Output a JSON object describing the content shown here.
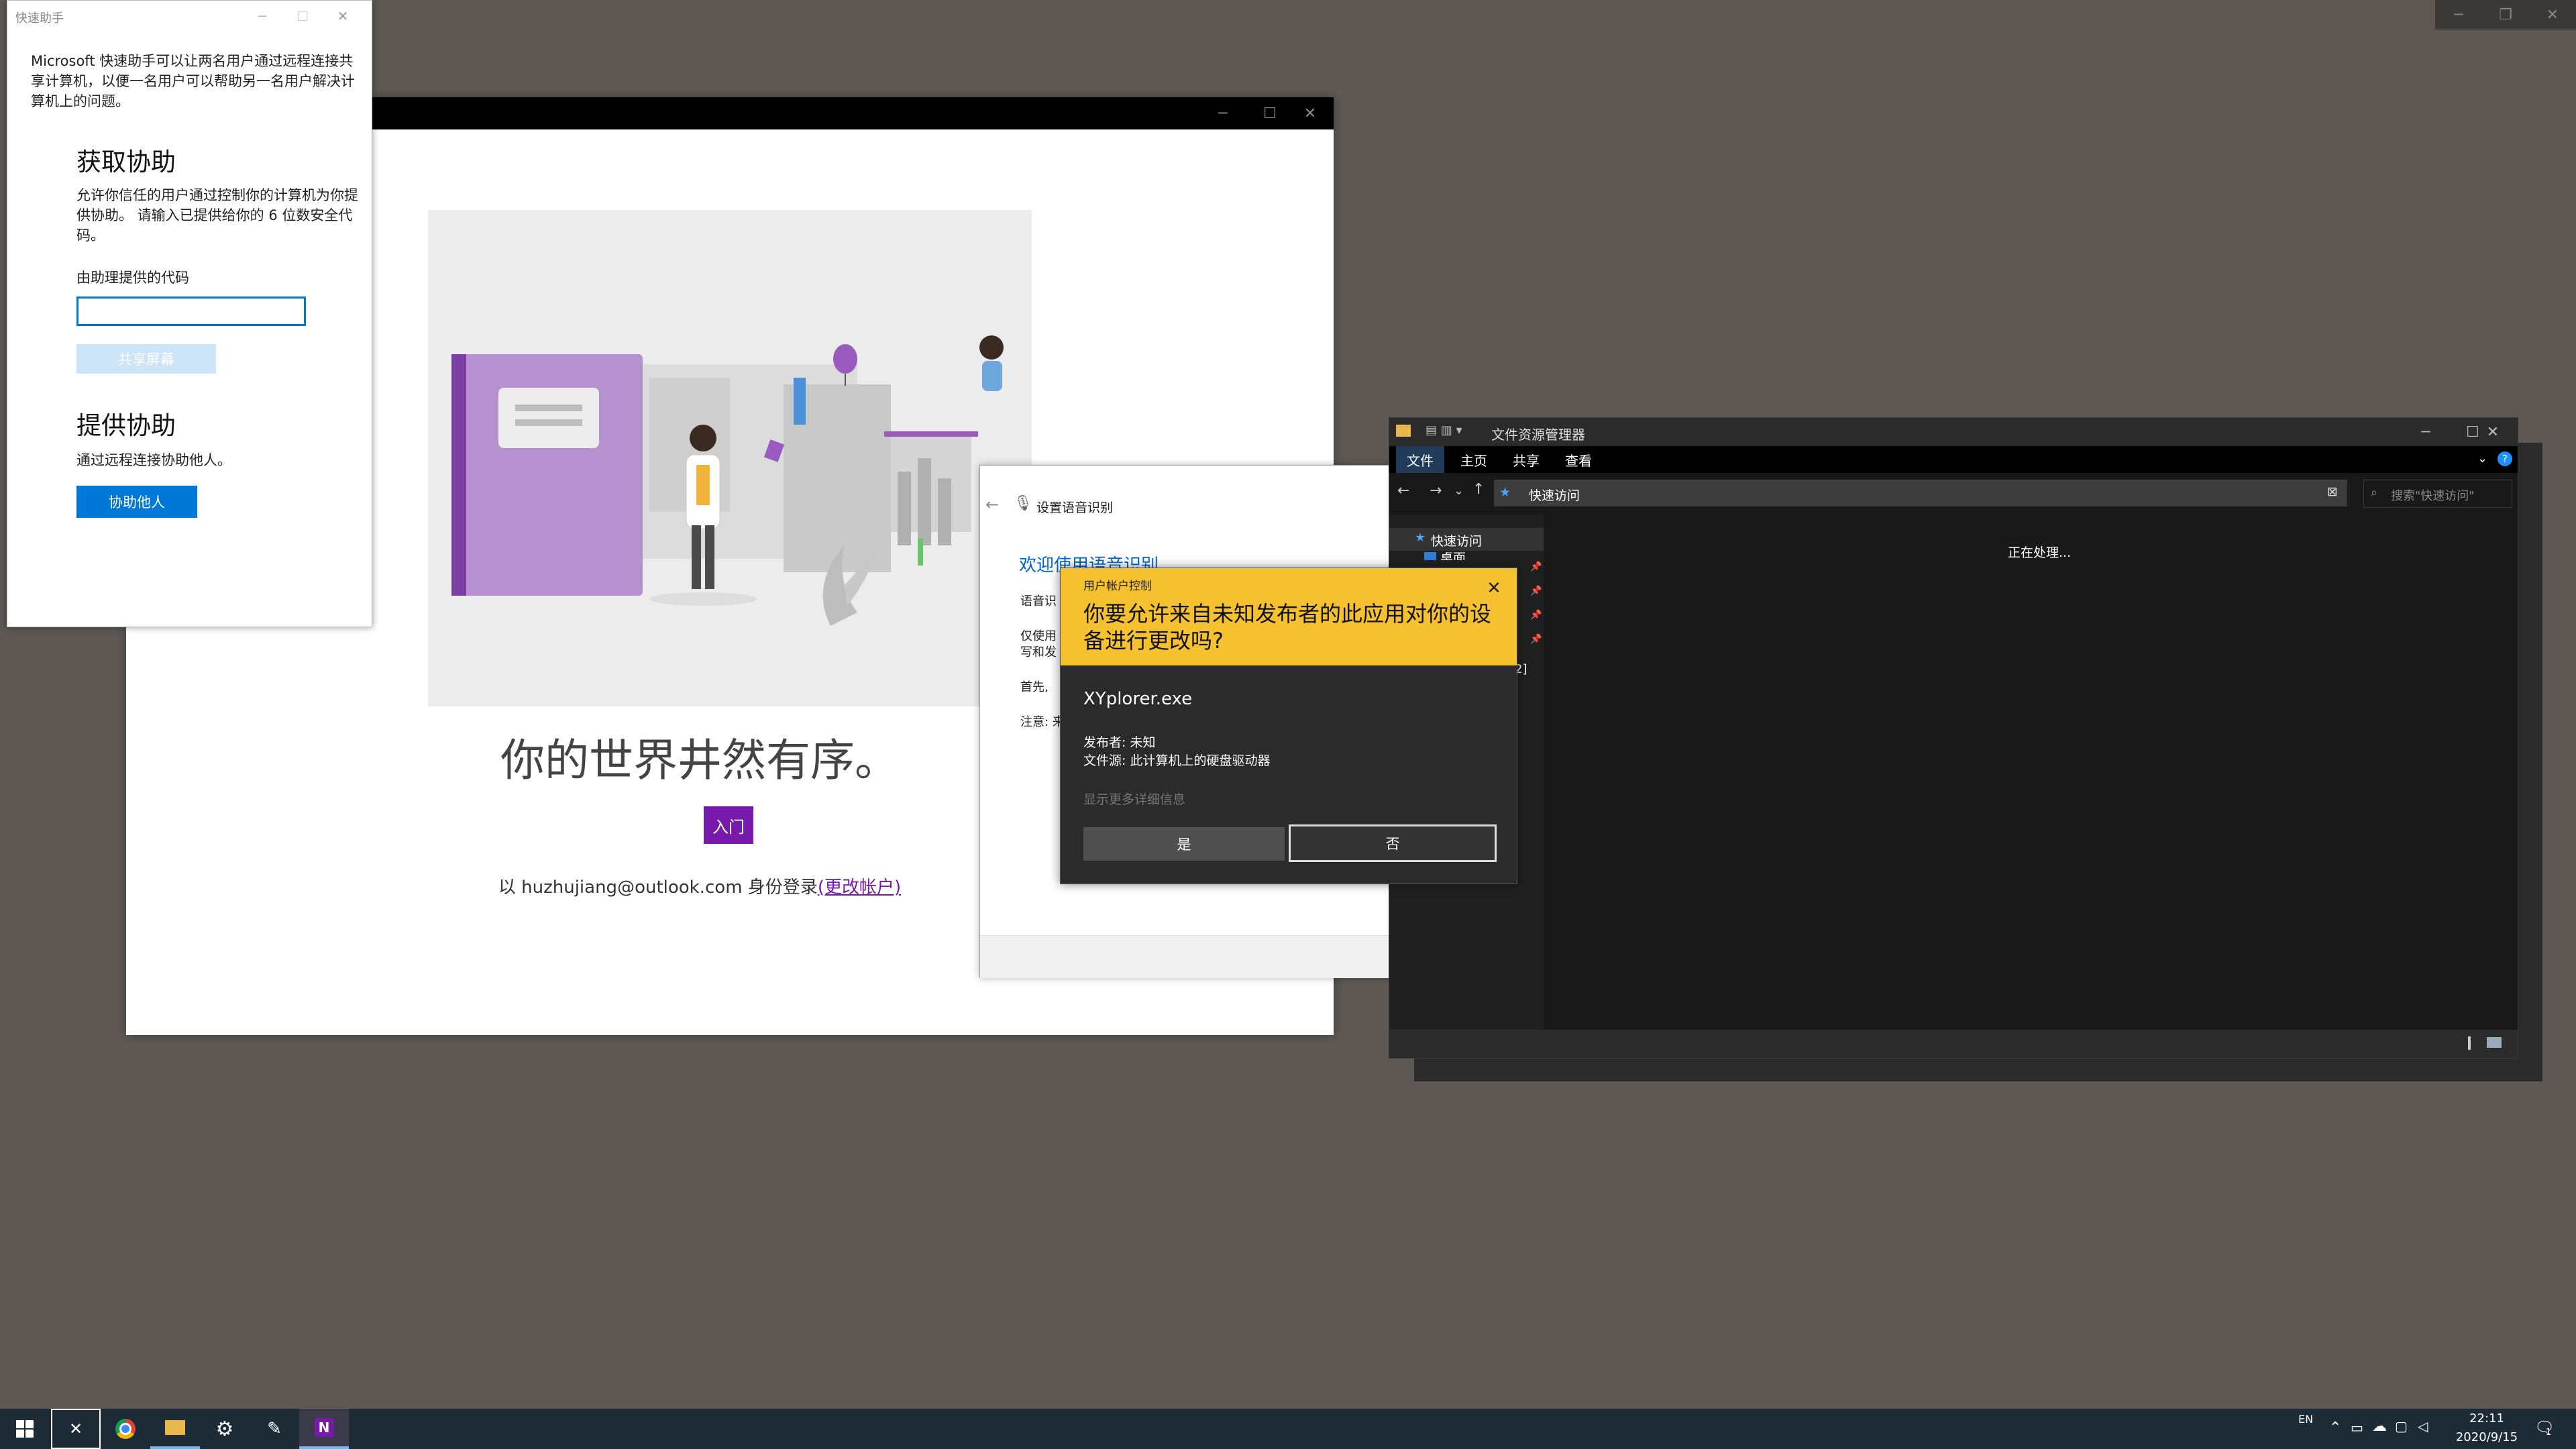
{
  "onenote": {
    "heading": "你的世界井然有序。",
    "start_button": "入门",
    "login_prefix": "以 huzhujiang@outlook.com 身份登录",
    "change_account": "(更改帐户)"
  },
  "quick_assist": {
    "title": "快速助手",
    "intro": "Microsoft 快速助手可以让两名用户通过远程连接共享计算机，以便一名用户可以帮助另一名用户解决计算机上的问题。",
    "get_help_heading": "获取协助",
    "get_help_desc": "允许你信任的用户通过控制你的计算机为你提供协助。 请输入已提供给你的 6 位数安全代码。",
    "code_label": "由助理提供的代码",
    "code_value": "",
    "share_button": "共享屏幕",
    "give_help_heading": "提供协助",
    "give_help_desc": "通过远程连接协助他人。",
    "help_button": "协助他人"
  },
  "speech": {
    "title": "设置语音识别",
    "welcome": "欢迎使用语音识别",
    "lines": [
      "语音识",
      "仅使用",
      "写和发",
      "首先,",
      "注意: 来"
    ]
  },
  "explorer": {
    "title": "文件资源管理器",
    "tabs": [
      "文件",
      "主页",
      "共享",
      "查看"
    ],
    "address": "快速访问",
    "search_placeholder": "搜索\"快速访问\"",
    "nav_quick_access": "快速访问",
    "nav_item": "桌面",
    "nav_clip": "[2]",
    "processing": "正在处理..."
  },
  "uac": {
    "title": "用户帐户控制",
    "question": "你要允许来自未知发布者的此应用对你的设备进行更改吗?",
    "app_name": "XYplorer.exe",
    "publisher": "发布者: 未知",
    "origin": "文件源: 此计算机上的硬盘驱动器",
    "more_details": "显示更多详细信息",
    "yes": "是",
    "no": "否"
  },
  "taskbar": {
    "language": "EN",
    "time": "22:11",
    "date": "2020/9/15",
    "notification_count": "1",
    "apps": [
      "xyplorer",
      "chrome",
      "file-explorer",
      "settings",
      "tool",
      "onenote"
    ]
  },
  "colors": {
    "onenote_purple": "#7719aa",
    "uac_yellow": "#f5c12e",
    "windows_blue": "#0078d7",
    "desktop": "#5d5853"
  }
}
